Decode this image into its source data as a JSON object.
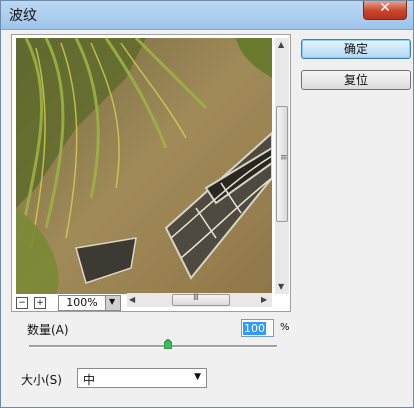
{
  "window": {
    "title": "波纹",
    "close_glyph": "✕"
  },
  "buttons": {
    "ok": "确定",
    "reset": "复位"
  },
  "preview": {
    "zoom_minus": "−",
    "zoom_plus": "+",
    "zoom_level": "100%",
    "scroll_grip_v": "≡",
    "scroll_grip_h": "III"
  },
  "amount": {
    "label": "数量(A)",
    "value": "100",
    "unit": "%",
    "slider_fraction": 0.56
  },
  "size": {
    "label": "大小(S)",
    "selected": "中"
  },
  "icons": {
    "up": "▲",
    "down": "▼",
    "left": "◀",
    "right": "▶"
  }
}
